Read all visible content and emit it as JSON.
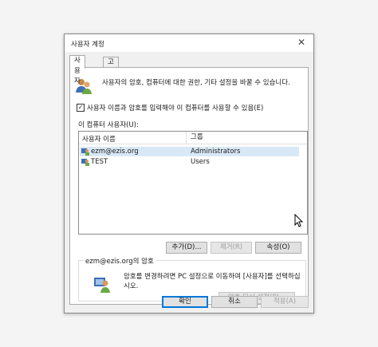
{
  "window": {
    "title": "사용자 계정",
    "close_glyph": "✕"
  },
  "tabs": [
    {
      "label": "사용자",
      "active": true
    },
    {
      "label": "고급",
      "active": false
    }
  ],
  "intro_text": "사용자의 암호, 컴퓨터에 대한 권한, 기타 설정을 바꿀 수 있습니다.",
  "require_login": {
    "label": "사용자 이름과 암호를 입력해야 이 컴퓨터를 사용할 수 있음(E)",
    "checked": true
  },
  "users_list": {
    "label": "이 컴퓨터 사용자(U):",
    "columns": [
      "사용자 이름",
      "그룹"
    ],
    "rows": [
      {
        "name": "ezm@ezis.org",
        "group": "Administrators",
        "selected": true
      },
      {
        "name": "TEST",
        "group": "Users",
        "selected": false
      }
    ]
  },
  "list_buttons": {
    "add": "추가(D)...",
    "remove": "제거(R)",
    "properties": "속성(O)"
  },
  "password_section": {
    "legend": "ezm@ezis.org의 암호",
    "text": "암호를 변경하려면 PC 설정으로 이동하여 [사용자]를 선택하십시오.",
    "reset_button": "암호 다시 설정(P)..."
  },
  "footer": {
    "ok": "확인",
    "cancel": "취소",
    "apply": "적용(A)"
  },
  "icons": [
    "users-icon",
    "user-row-icon",
    "password-user-icon",
    "mouse-cursor-icon"
  ]
}
